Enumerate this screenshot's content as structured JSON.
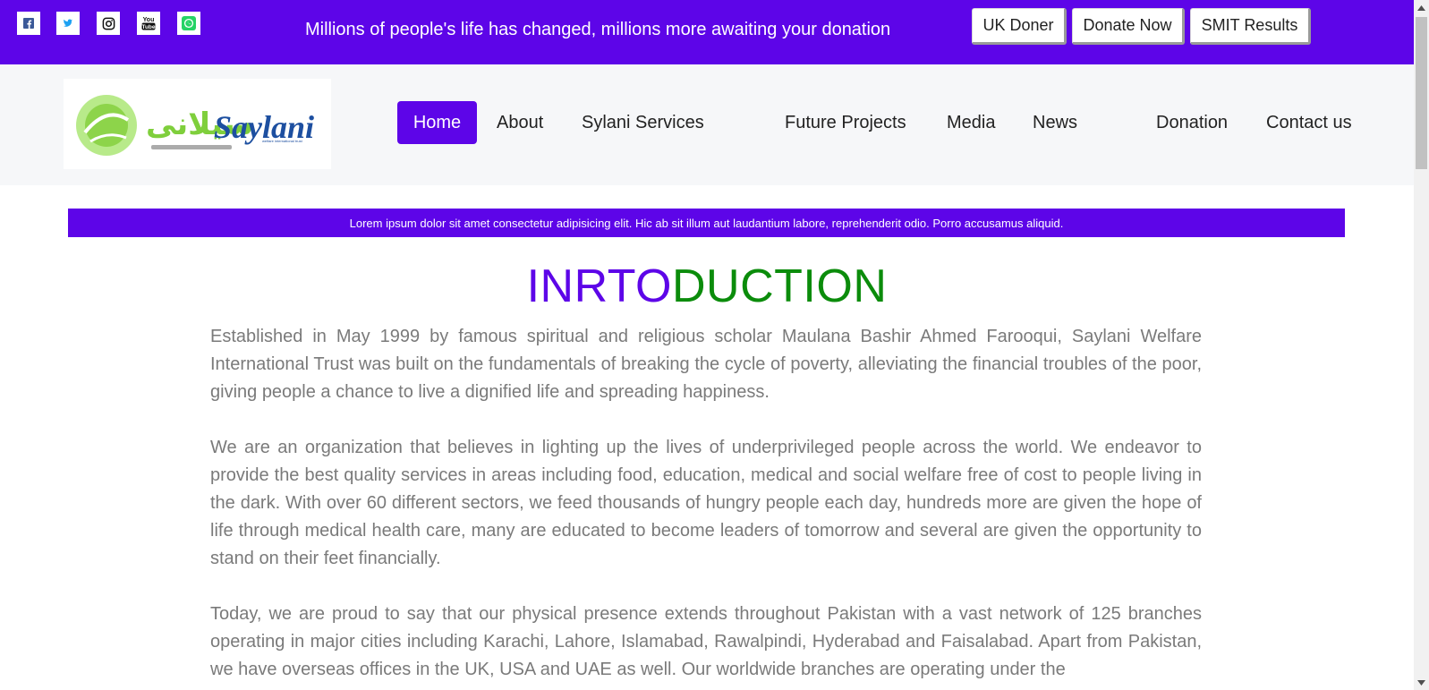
{
  "topbar": {
    "social_icons": [
      "facebook-icon",
      "twitter-icon",
      "instagram-icon",
      "youtube-icon",
      "whatsapp-icon"
    ],
    "tagline": "Millions of people's life has changed, millions more awaiting your donation",
    "buttons": {
      "uk_doner": "UK Doner",
      "donate_now": "Donate Now",
      "smit_results": "SMIT Results"
    }
  },
  "logo": {
    "brand_text": "Saylani",
    "urdu_text": "سیلانی",
    "sub_text": "welfare international trust"
  },
  "nav": {
    "items": [
      {
        "label": "Home"
      },
      {
        "label": "About"
      },
      {
        "label": "Sylani Services"
      },
      {
        "label": "Future Projects"
      },
      {
        "label": "Media"
      },
      {
        "label": "News"
      },
      {
        "label": "Donation"
      },
      {
        "label": "Contact us"
      }
    ]
  },
  "strip": {
    "text": "Lorem ipsum dolor sit amet consectetur adipisicing elit. Hic ab sit illum aut laudantium labore, reprehenderit odio. Porro accusamus aliquid."
  },
  "intro": {
    "heading_part1": "INRTO",
    "heading_part2": "DUCTION",
    "paragraphs": [
      "Established in May 1999 by famous spiritual and religious scholar Maulana Bashir Ahmed Farooqui, Saylani Welfare International Trust was built on the fundamentals of breaking the cycle of poverty, alleviating the financial troubles of the poor, giving people a chance to live a dignified life and spreading happiness.",
      "We are an organization that believes in lighting up the lives of underprivileged people across the world. We endeavor to provide the best quality services in areas including food, education, medical and social welfare free of cost to people living in the dark. With over 60 different sectors, we feed thousands of hungry people each day, hundreds more are given the hope of life through medical health care, many are educated to become leaders of tomorrow and several are given the opportunity to stand on their feet financially.",
      "Today, we are proud to say that our physical presence extends throughout Pakistan with a vast network of 125 branches operating in major cities including Karachi, Lahore, Islamabad, Rawalpindi, Hyderabad and Faisalabad. Apart from Pakistan, we have overseas offices in the UK, USA and UAE as well. Our worldwide branches are operating under the"
    ]
  },
  "colors": {
    "brand_purple": "#5d05e8",
    "brand_green": "#0b8c0b",
    "body_text": "#7a7a7a",
    "logo_green": "#8dd44a",
    "logo_blue": "#1d4fa0"
  }
}
